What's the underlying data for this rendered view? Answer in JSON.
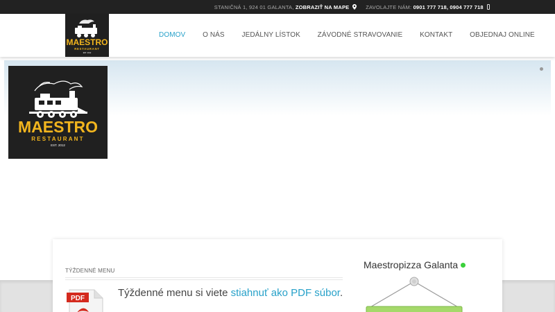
{
  "topbar": {
    "address": "STANIČNÁ 1, 924 01 GALANTA,",
    "map_link": "ZOBRAZIŤ NA MAPE",
    "call_label": "ZAVOLAJTE NÁM:",
    "phones": "0901 777 718, 0904 777 718"
  },
  "logo": {
    "brand": "MAESTRO",
    "sub": "RESTAURANT",
    "est": "EST. 2012"
  },
  "nav": {
    "items": [
      {
        "label": "DOMOV",
        "active": true
      },
      {
        "label": "O NÁS"
      },
      {
        "label": "JEDÁLNY LÍSTOK"
      },
      {
        "label": "ZÁVODNÉ STRAVOVANIE"
      },
      {
        "label": "KONTAKT"
      },
      {
        "label": "OBJEDNAJ ONLINE"
      }
    ]
  },
  "weekly_menu": {
    "label": "TÝŽDENNÉ MENU",
    "text_prefix": "Týždenné menu si viete",
    "link_text": "stiahnuť ako PDF súbor",
    "text_suffix": ".",
    "pdf_badge": "PDF"
  },
  "sidebar": {
    "title": "Maestropizza Galanta"
  },
  "colors": {
    "accent": "#27a1c9",
    "topbar_bg": "#222222",
    "logo_bg": "#202020",
    "logo_yellow": "#f2b51e",
    "status_green": "#3bd03b",
    "pdf_red": "#d42a1e",
    "sign_green": "#a5d96a"
  },
  "icons": {
    "map_pin": "map-pin-icon",
    "phone": "phone-icon",
    "pdf": "pdf-file-icon",
    "status": "online-status-icon"
  }
}
